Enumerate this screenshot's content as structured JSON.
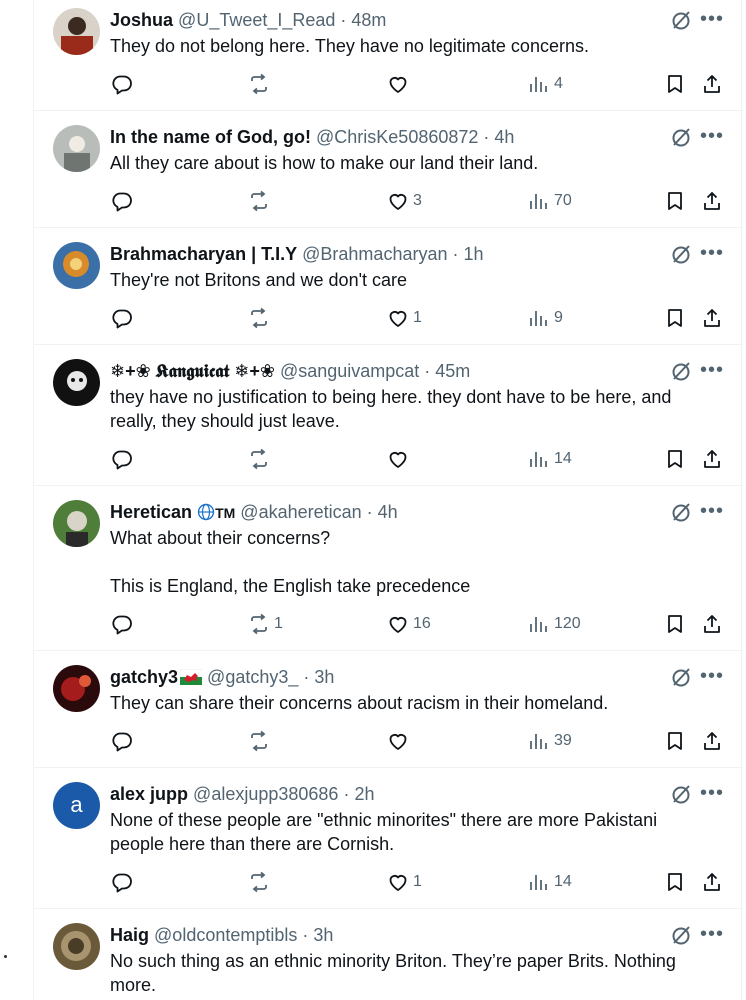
{
  "tweets": [
    {
      "name": "Joshua",
      "handle": "@U_Tweet_I_Read",
      "time": "48m",
      "text": "They do not belong here. They have no legitimate concerns.",
      "replies": "",
      "retweets": "",
      "likes": "",
      "views": "4",
      "avatar_color": "#9a2a1a"
    },
    {
      "name": "In the name of God, go!",
      "handle": "@ChrisKe50860872",
      "time": "4h",
      "text": "All they care about is how to make our land their land.",
      "replies": "",
      "retweets": "",
      "likes": "3",
      "views": "70",
      "avatar_color": "#8a8f8c"
    },
    {
      "name": "Brahmacharyan | T.I.Y",
      "handle": "@Brahmacharyan",
      "time": "1h",
      "text": "They're not Britons and we don't care",
      "replies": "",
      "retweets": "",
      "likes": "1",
      "views": "9",
      "avatar_color": "#3a6fa8"
    },
    {
      "name": "❄+❀ 𝕶𝖆𝖓𝖌𝖚𝖎𝖈𝖆𝖙 ❄+❀",
      "handle": "@sanguivampcat",
      "time": "45m",
      "text": "they have no justification to being here. they dont have to be here, and really, they should just leave.",
      "replies": "",
      "retweets": "",
      "likes": "",
      "views": "14",
      "avatar_color": "#111111"
    },
    {
      "name": "Heretican",
      "name_suffix": "TM",
      "handle": "@akaheretican",
      "time": "4h",
      "text": "What about their concerns?\n\nThis is England, the English take precedence",
      "replies": "",
      "retweets": "1",
      "likes": "16",
      "views": "120",
      "avatar_color": "#4f7d3a"
    },
    {
      "name": "gatchy3",
      "handle": "@gatchy3_",
      "time": "3h",
      "text": "They can share their concerns about racism in their homeland.",
      "replies": "",
      "retweets": "",
      "likes": "",
      "views": "39",
      "avatar_color": "#5a1010"
    },
    {
      "name": "alex jupp",
      "handle": "@alexjupp380686",
      "time": "2h",
      "text": "None of these people are \"ethnic minorites\" there are more Pakistani people here than there are Cornish.",
      "replies": "",
      "retweets": "",
      "likes": "1",
      "views": "14",
      "avatar_letter": "a",
      "avatar_color": "#1a5aa8"
    },
    {
      "name": "Haig",
      "handle": "@oldcontemptibls",
      "time": "3h",
      "text": "No such thing as an ethnic minority Briton. They’re paper Brits. Nothing more.",
      "replies": "",
      "retweets": "",
      "likes": "",
      "views": "",
      "avatar_color": "#6b5a3a"
    }
  ],
  "icons": {
    "reply": "reply-icon",
    "retweet": "retweet-icon",
    "like": "heart-icon",
    "views": "views-icon",
    "bookmark": "bookmark-icon",
    "share": "share-icon",
    "grok": "grok-icon",
    "more": "more-icon"
  },
  "colors": {
    "text": "#0f1419",
    "secondary": "#536471",
    "border": "#eff3f4"
  }
}
